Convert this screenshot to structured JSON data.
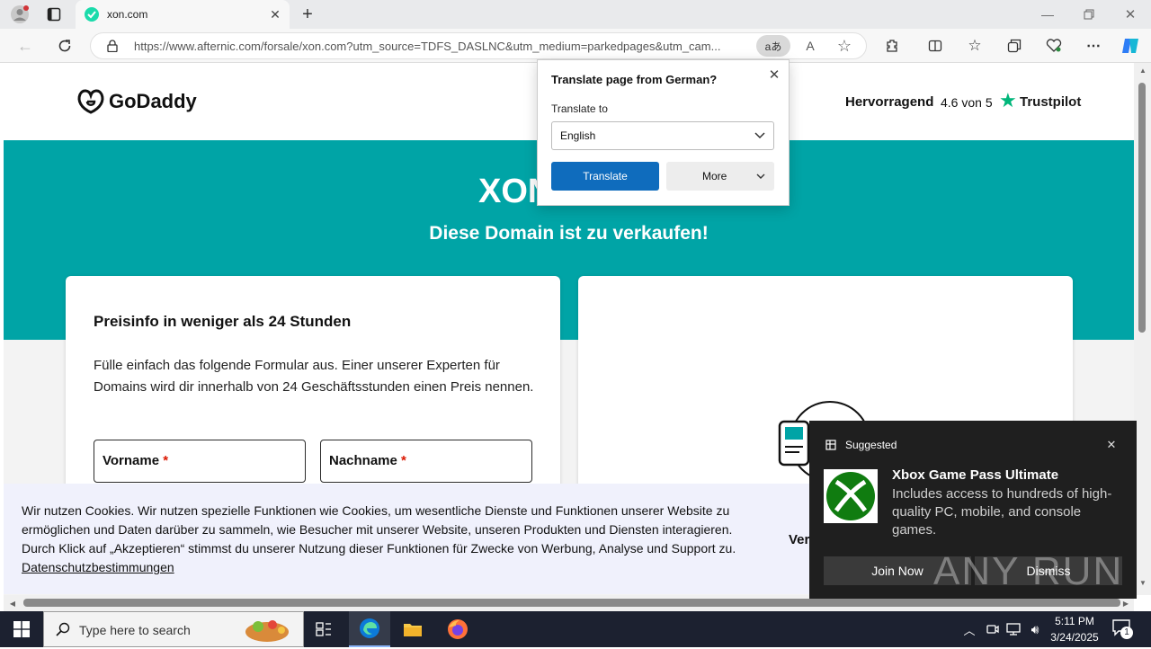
{
  "browser": {
    "tab_title": "xon.com",
    "url": "https://www.afternic.com/forsale/xon.com?utm_source=TDFS_DASLNC&utm_medium=parkedpages&utm_cam...",
    "read_aloud_glyph": "A͆",
    "translate_glyph": "aあ"
  },
  "header": {
    "logo": "GoDaddy",
    "rating_word": "Hervorragend",
    "rating_score": "4.6 von 5",
    "trustpilot": "Trustpilot"
  },
  "hero": {
    "domain": "xon.com",
    "domain_visible": "XON",
    "subtitle": "Diese Domain ist zu verkaufen!"
  },
  "form_card": {
    "title": "Preisinfo in weniger als 24 Stunden",
    "description": "Fülle einfach das folgende Formular aus. Einer unserer Experten für Domains wird dir innerhalb von 24 Geschäftsstunden einen Preis nennen.",
    "first_name_label": "Vorname",
    "last_name_label": "Nachname",
    "required_mark": "*"
  },
  "right_card": {
    "partial_text": "Ver"
  },
  "cookie_banner": {
    "text": "Wir nutzen Cookies. Wir nutzen spezielle Funktionen wie Cookies, um wesentliche Dienste und Funktionen unserer Website zu ermöglichen und Daten darüber zu sammeln, wie Besucher mit unserer Website, unseren Produkten und Diensten interagieren. Durch Klick auf „Akzeptieren“ stimmst du unserer Nutzung dieser Funktionen für Zwecke von Werbung, Analyse und Support zu.",
    "link": "Datenschutzbestimmungen"
  },
  "translate_popup": {
    "title": "Translate page from German?",
    "translate_to_label": "Translate to",
    "language": "English",
    "translate_button": "Translate",
    "more_button": "More"
  },
  "toast": {
    "header": "Suggested",
    "title": "Xbox Game Pass Ultimate",
    "body": "Includes access to hundreds of high-quality PC, mobile, and console games.",
    "join_button": "Join Now",
    "dismiss_button": "Dismiss",
    "watermark": "ANY RUN"
  },
  "taskbar": {
    "search_placeholder": "Type here to search",
    "time": "5:11 PM",
    "date": "3/24/2025",
    "notification_count": "1"
  },
  "colors": {
    "teal": "#00a4a6",
    "primary_blue": "#0f6cbd",
    "required_red": "#db1802",
    "trustpilot_green": "#00b67a"
  }
}
